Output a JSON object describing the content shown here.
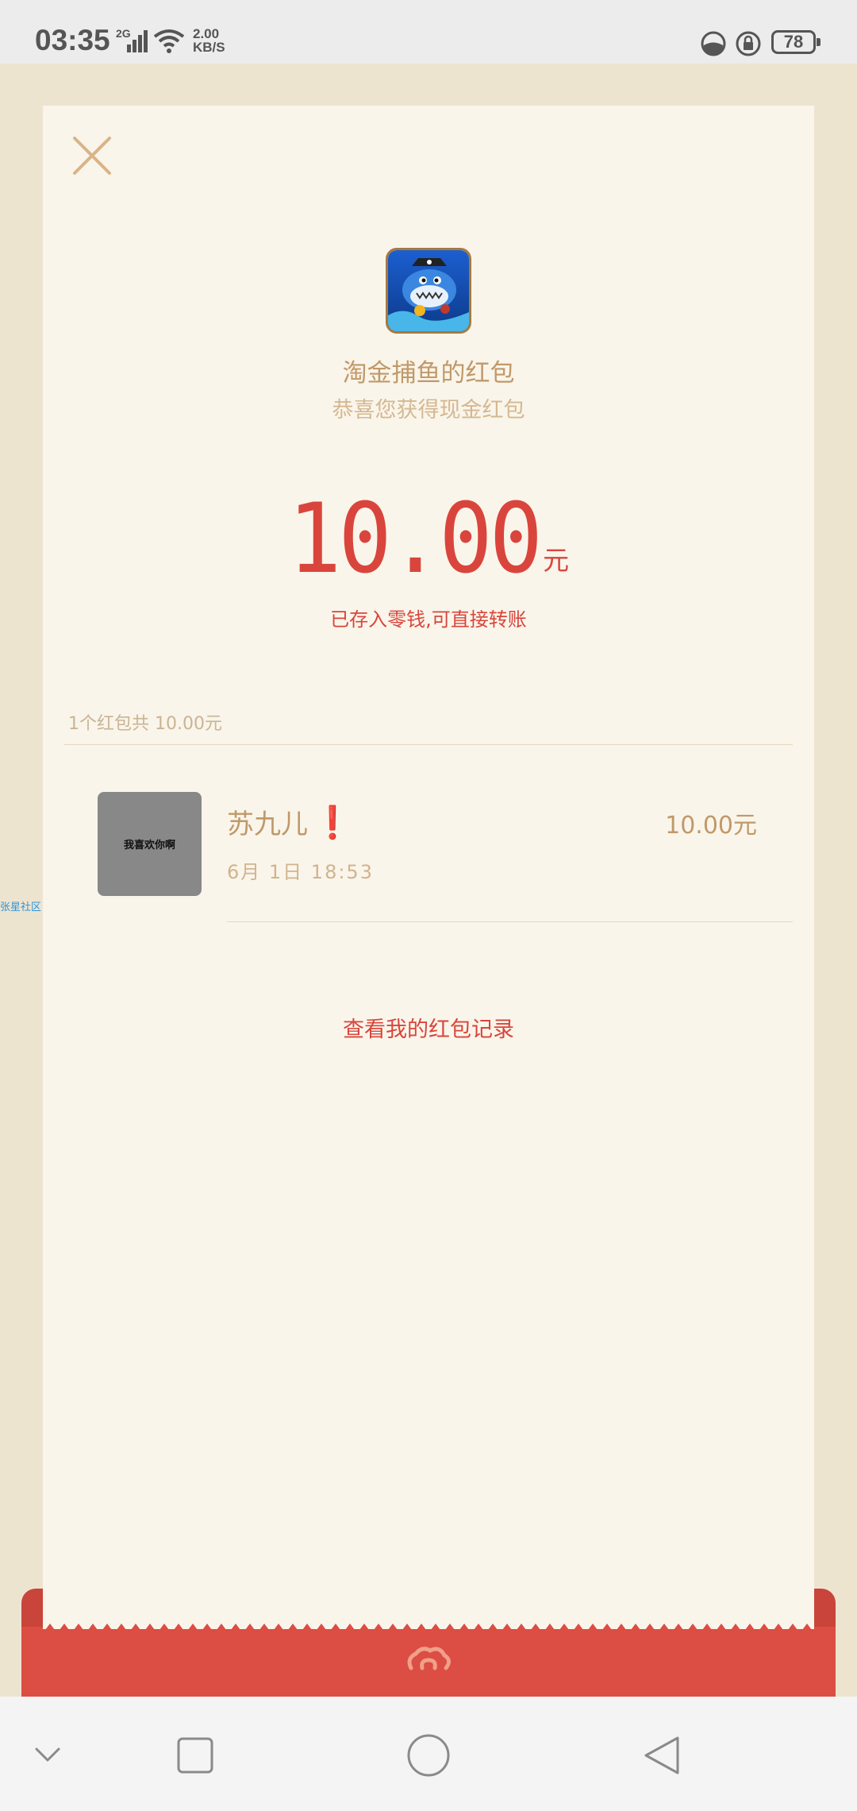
{
  "status_bar": {
    "time": "03:35",
    "network": "2G",
    "speed_value": "2.00",
    "speed_unit": "KB/S",
    "battery": "78"
  },
  "packet": {
    "title": "淘金捕鱼的红包",
    "subtitle": "恭喜您获得现金红包",
    "amount": "10.00",
    "amount_unit": "元",
    "stored_note": "已存入零钱,可直接转账",
    "summary": "1个红包共 10.00元"
  },
  "record": {
    "avatar_text": "我喜欢你啊",
    "sender": "苏九儿",
    "sender_mark": "❗",
    "amount": "10.00元",
    "time": "6月 1日 18:53"
  },
  "side_label": "张星社区",
  "history_link": "查看我的红包记录",
  "colors": {
    "accent_red": "#d9453c",
    "gold_text": "#c0996a",
    "card_bg": "#faf5ea",
    "page_bg": "#ede4d0",
    "envelope_red": "#dc4d43"
  },
  "icons": {
    "close": "close-icon",
    "envelope_logo": "envelope-cloud-icon",
    "nav_down": "chevron-down-icon",
    "nav_recent": "recent-apps-icon",
    "nav_home": "home-icon",
    "nav_back": "back-icon"
  }
}
